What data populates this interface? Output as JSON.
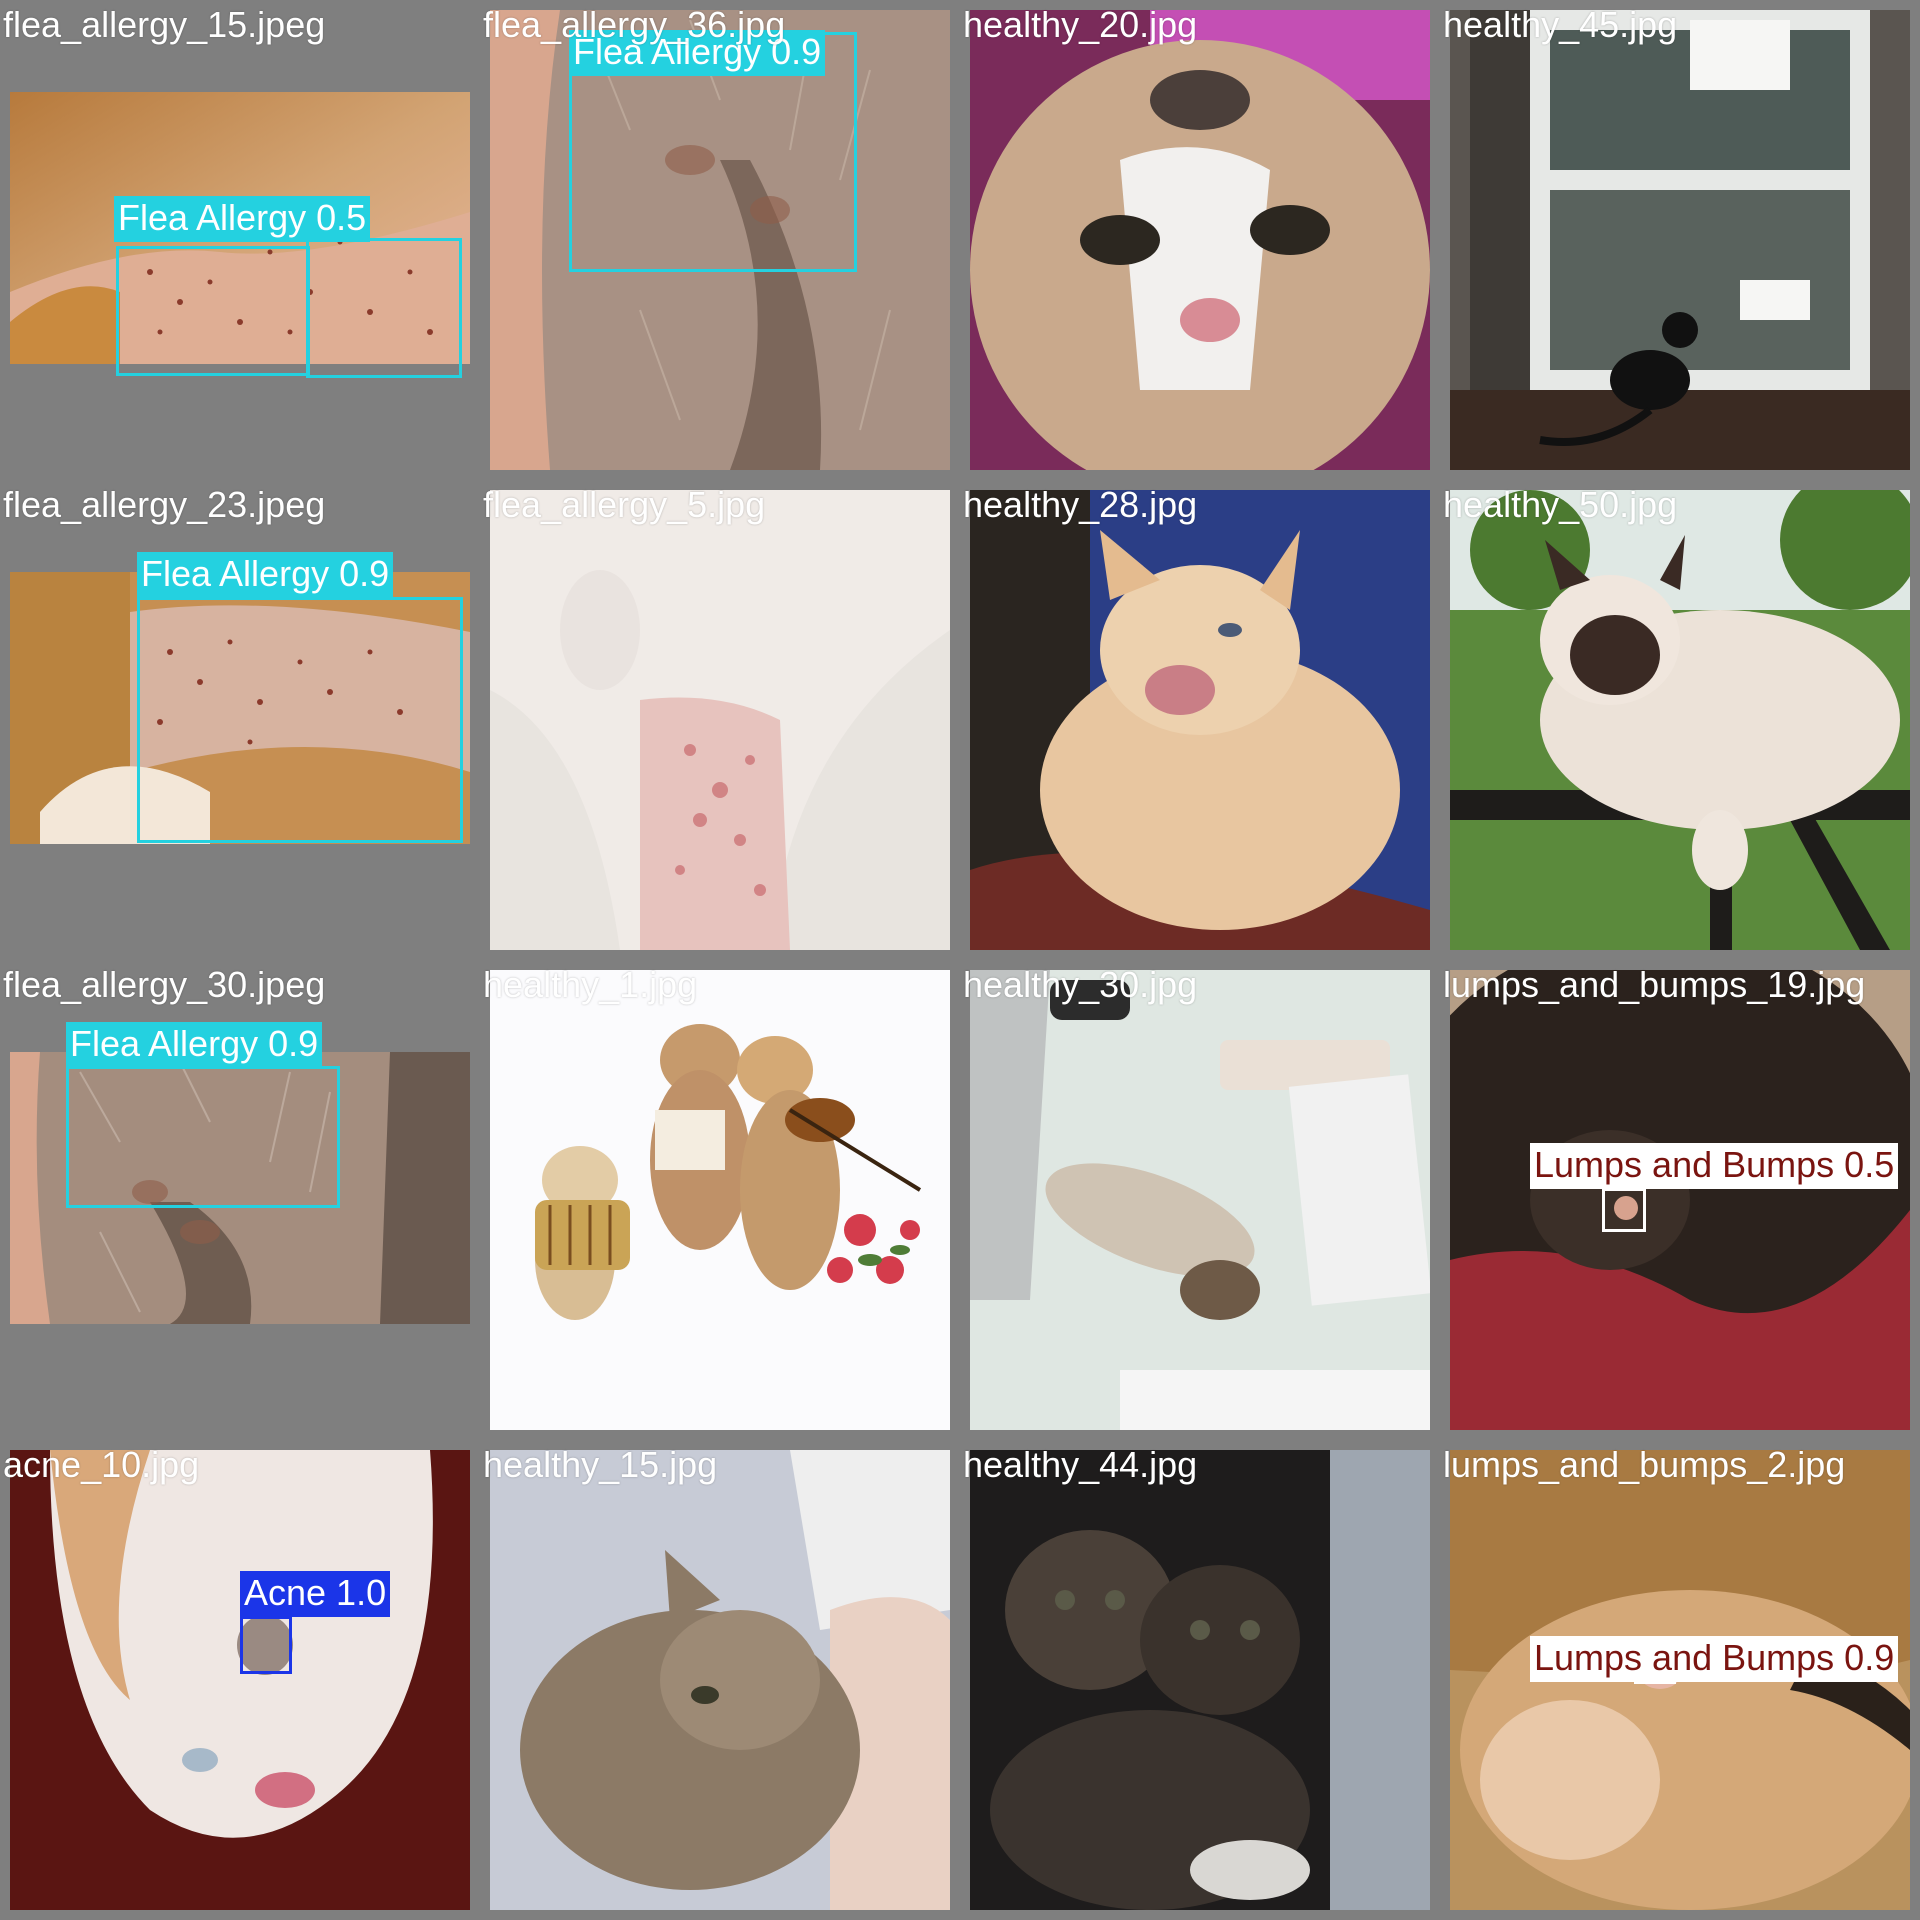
{
  "colors": {
    "grid_background": "#7f7f7f",
    "flea_allergy": "#24d1e0",
    "acne": "#1b35e8",
    "lumps_and_bumps": "#ffffff",
    "lumps_label_text": "#7a1410"
  },
  "tiles": [
    {
      "filename": "flea_allergy_15.jpeg",
      "photo": "skin-with-flea-bites",
      "detections": [
        {
          "label": "Flea Allergy 0.5"
        }
      ]
    },
    {
      "filename": "flea_allergy_36.jpg",
      "photo": "cat-fur-close-up",
      "detections": [
        {
          "label": "Flea Allergy 0.9"
        }
      ]
    },
    {
      "filename": "healthy_20.jpg",
      "photo": "calico-cat-face",
      "detections": []
    },
    {
      "filename": "healthy_45.jpg",
      "photo": "black-cat-at-door",
      "detections": []
    },
    {
      "filename": "flea_allergy_23.jpeg",
      "photo": "orange-fur-with-scabs",
      "detections": [
        {
          "label": "Flea Allergy 0.9"
        }
      ]
    },
    {
      "filename": "flea_allergy_5.jpg",
      "photo": "pink-belly-rash",
      "detections": []
    },
    {
      "filename": "healthy_28.jpg",
      "photo": "orange-kitten-meowing",
      "detections": []
    },
    {
      "filename": "healthy_50.jpg",
      "photo": "birman-cat-on-railing",
      "detections": []
    },
    {
      "filename": "flea_allergy_30.jpeg",
      "photo": "cat-fur-close-up",
      "detections": [
        {
          "label": "Flea Allergy 0.9"
        }
      ]
    },
    {
      "filename": "healthy_1.jpg",
      "photo": "vintage-kittens-with-instruments",
      "detections": []
    },
    {
      "filename": "healthy_30.jpg",
      "photo": "kitten-sleeping-on-desk",
      "detections": []
    },
    {
      "filename": "lumps_and_bumps_19.jpg",
      "photo": "dark-cat-on-red-blanket",
      "detections": [
        {
          "label": "Lumps and Bumps 0.5"
        }
      ]
    },
    {
      "filename": "acne_10.jpg",
      "photo": "white-cat-chin",
      "detections": [
        {
          "label": "Acne 1.0"
        }
      ]
    },
    {
      "filename": "healthy_15.jpg",
      "photo": "tabby-kitten-nursing",
      "detections": []
    },
    {
      "filename": "healthy_44.jpg",
      "photo": "two-tabby-kittens",
      "detections": []
    },
    {
      "filename": "lumps_and_bumps_2.jpg",
      "photo": "orange-cat-chin",
      "detections": [
        {
          "label": "Lumps and Bumps 0.9"
        }
      ]
    }
  ]
}
